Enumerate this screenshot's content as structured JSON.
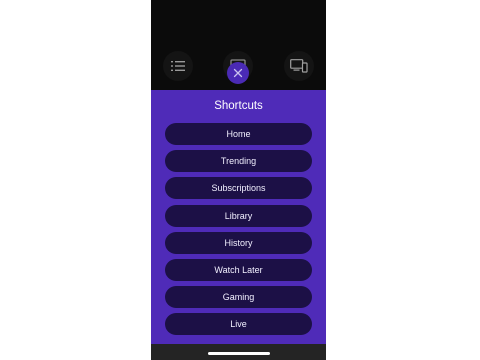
{
  "header": {
    "icons": {
      "left": "list-icon",
      "middle": "cast-icon",
      "right": "devices-icon",
      "close": "close-icon"
    }
  },
  "shortcuts": {
    "title": "Shortcuts",
    "items": [
      {
        "label": "Home"
      },
      {
        "label": "Trending"
      },
      {
        "label": "Subscriptions"
      },
      {
        "label": "Library"
      },
      {
        "label": "History"
      },
      {
        "label": "Watch Later"
      },
      {
        "label": "Gaming"
      },
      {
        "label": "Live"
      }
    ]
  },
  "colors": {
    "sheet": "#4f2bb8",
    "pill": "#1c1046",
    "close": "#4a2ab5",
    "background": "#0b0b0b"
  }
}
